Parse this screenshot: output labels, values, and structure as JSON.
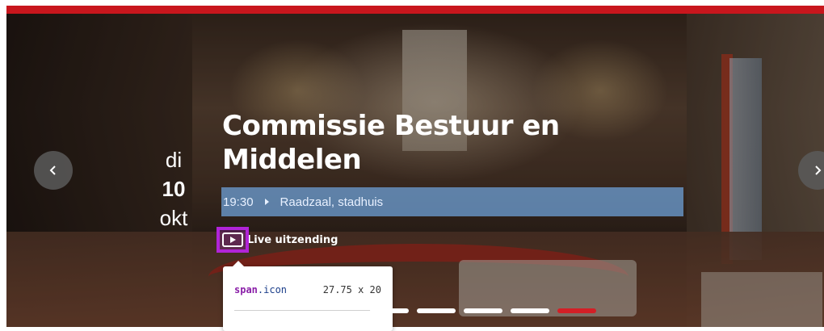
{
  "hero": {
    "date": {
      "weekday": "di",
      "day": "10",
      "month": "okt"
    },
    "title_line1": "Commissie Bestuur en",
    "title_line2": "Middelen",
    "time": "19:30",
    "location": "Raadzaal, stadhuis",
    "live_label": "Live uitzending"
  },
  "tooltip": {
    "selector_tag": "span",
    "selector_class": ".icon",
    "dimensions": "27.75 x 20"
  },
  "carousel": {
    "slide_count": 5,
    "active_index": 4
  },
  "colors": {
    "brand_red": "#c8161d",
    "highlight": "#b124d8",
    "meta_bar": "#6ea0d7"
  },
  "icons": {
    "prev": "chevron-left-icon",
    "next": "chevron-right-icon",
    "live": "video-play-icon"
  }
}
